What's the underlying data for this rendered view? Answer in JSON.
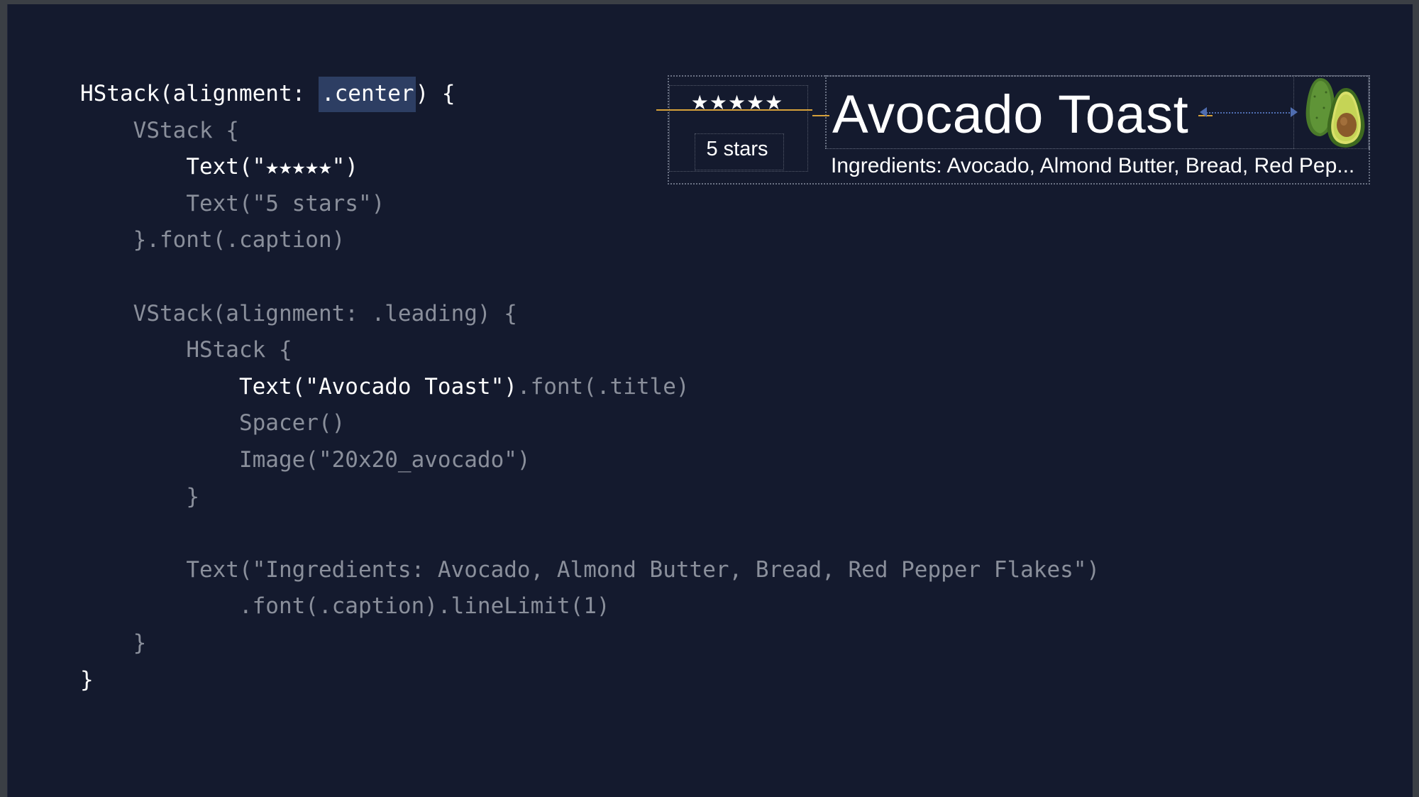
{
  "code": {
    "lines": [
      {
        "indent": "",
        "parts": [
          {
            "t": "HStack(alignment: ",
            "c": "hl"
          },
          {
            "t": ".center",
            "c": "sel"
          },
          {
            "t": ") {",
            "c": "hl"
          }
        ]
      },
      {
        "indent": "    ",
        "parts": [
          {
            "t": "VStack {",
            "c": ""
          }
        ]
      },
      {
        "indent": "        ",
        "parts": [
          {
            "t": "Text(\"★★★★★\")",
            "c": "hl"
          }
        ]
      },
      {
        "indent": "        ",
        "parts": [
          {
            "t": "Text(\"5 stars\")",
            "c": ""
          }
        ]
      },
      {
        "indent": "    ",
        "parts": [
          {
            "t": "}.font(.caption)",
            "c": ""
          }
        ]
      },
      {
        "indent": "",
        "parts": [
          {
            "t": "",
            "c": ""
          }
        ]
      },
      {
        "indent": "    ",
        "parts": [
          {
            "t": "VStack(alignment: .leading) {",
            "c": ""
          }
        ]
      },
      {
        "indent": "        ",
        "parts": [
          {
            "t": "HStack {",
            "c": ""
          }
        ]
      },
      {
        "indent": "            ",
        "parts": [
          {
            "t": "Text(\"Avocado Toast\")",
            "c": "hl"
          },
          {
            "t": ".font(.title)",
            "c": ""
          }
        ]
      },
      {
        "indent": "            ",
        "parts": [
          {
            "t": "Spacer()",
            "c": ""
          }
        ]
      },
      {
        "indent": "            ",
        "parts": [
          {
            "t": "Image(\"20x20_avocado\")",
            "c": ""
          }
        ]
      },
      {
        "indent": "        ",
        "parts": [
          {
            "t": "}",
            "c": ""
          }
        ]
      },
      {
        "indent": "",
        "parts": [
          {
            "t": "",
            "c": ""
          }
        ]
      },
      {
        "indent": "        ",
        "parts": [
          {
            "t": "Text(\"Ingredients: Avocado, Almond Butter, Bread, Red Pepper Flakes\")",
            "c": ""
          }
        ]
      },
      {
        "indent": "            ",
        "parts": [
          {
            "t": ".font(.caption).lineLimit(1)",
            "c": ""
          }
        ]
      },
      {
        "indent": "    ",
        "parts": [
          {
            "t": "}",
            "c": ""
          }
        ]
      },
      {
        "indent": "",
        "parts": [
          {
            "t": "}",
            "c": "hl"
          }
        ]
      }
    ]
  },
  "preview": {
    "stars": "★★★★★",
    "rating_label": "5 stars",
    "title": "Avocado Toast",
    "ingredients": "Ingredients: Avocado, Almond Butter, Bread, Red Pep...",
    "image_icon": "avocado-icon"
  },
  "colors": {
    "background": "#141a2e",
    "code_text": "#8a8f9b",
    "code_highlight": "#ffffff",
    "selection": "#2d3e63",
    "alignment_guide": "#d6a13a",
    "spacer_guide": "#4f6db0"
  }
}
